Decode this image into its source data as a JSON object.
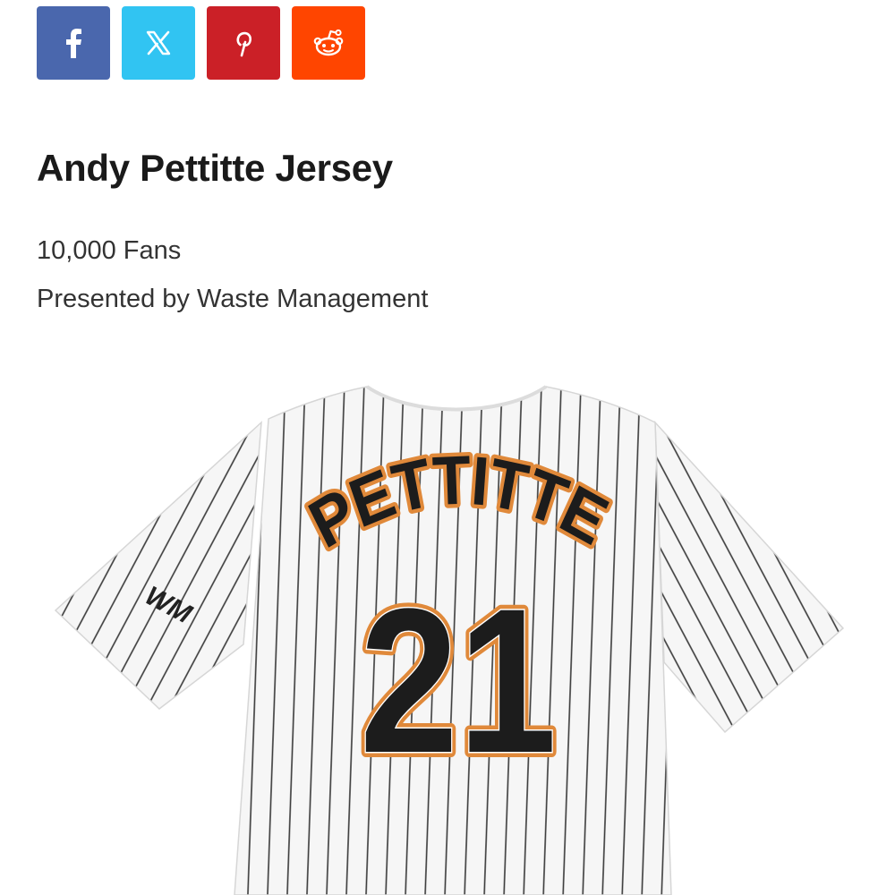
{
  "share": {
    "buttons": [
      {
        "name": "facebook",
        "icon": "facebook-icon",
        "color": "#4a67ad"
      },
      {
        "name": "x",
        "icon": "x-icon",
        "color": "#31c4f2"
      },
      {
        "name": "pinterest",
        "icon": "pinterest-icon",
        "color": "#cb2027"
      },
      {
        "name": "reddit",
        "icon": "reddit-icon",
        "color": "#ff4500"
      }
    ]
  },
  "item": {
    "title": "Andy Pettitte Jersey",
    "quantity": "10,000 Fans",
    "presenter": "Presented by Waste Management"
  },
  "jersey": {
    "name": "PETTITTE",
    "number": "21",
    "sleeve_patch": "WM",
    "colors": {
      "base": "#f6f6f6",
      "pinstripe": "#3a3a3a",
      "lettering": "#1c1c1c",
      "outline": "#e0893a"
    }
  }
}
